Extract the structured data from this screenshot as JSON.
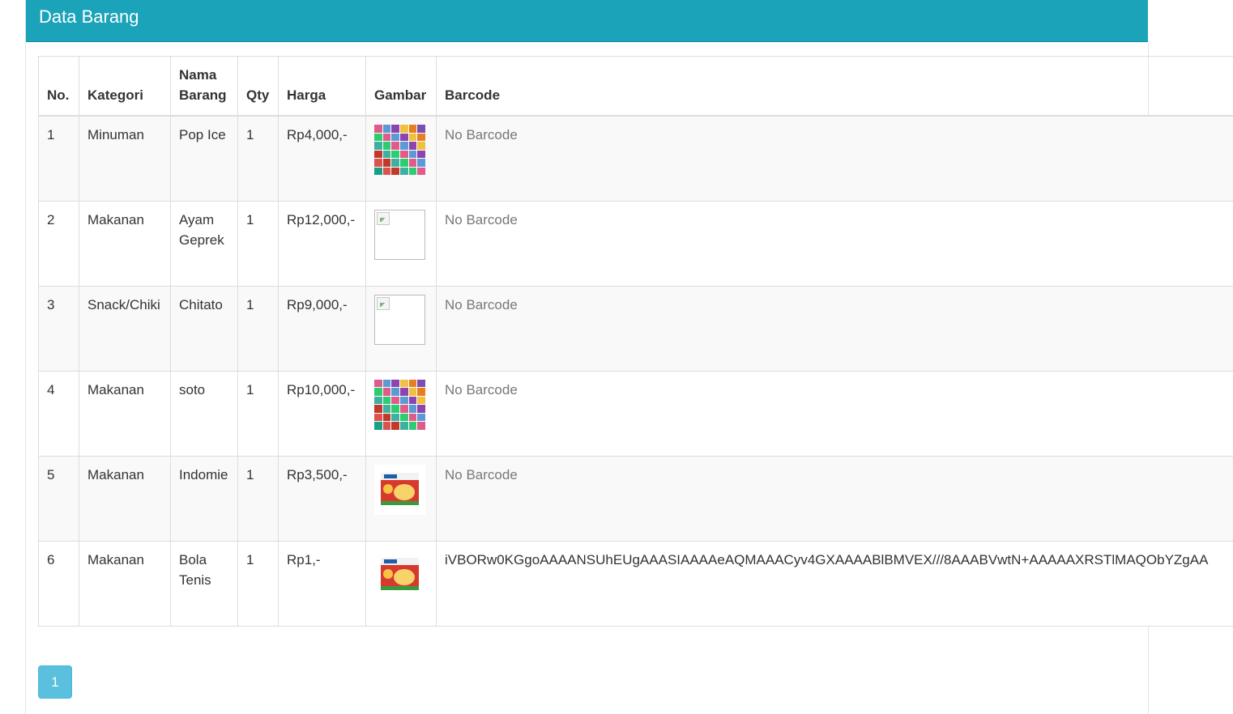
{
  "panel": {
    "title": "Data Barang"
  },
  "table": {
    "headers": {
      "no": "No.",
      "kategori": "Kategori",
      "nama_barang": "Nama Barang",
      "qty": "Qty",
      "harga": "Harga",
      "gambar": "Gambar",
      "barcode": "Barcode"
    },
    "rows": [
      {
        "no": "1",
        "kategori": "Minuman",
        "nama": "Pop Ice",
        "qty": "1",
        "harga": "Rp4,000,-",
        "gambar": "mosaic-product-image",
        "barcode": "No Barcode"
      },
      {
        "no": "2",
        "kategori": "Makanan",
        "nama": "Ayam Geprek",
        "qty": "1",
        "harga": "Rp12,000,-",
        "gambar": "broken-image",
        "barcode": "No Barcode"
      },
      {
        "no": "3",
        "kategori": "Snack/Chiki",
        "nama": "Chitato",
        "qty": "1",
        "harga": "Rp9,000,-",
        "gambar": "broken-image",
        "barcode": "No Barcode"
      },
      {
        "no": "4",
        "kategori": "Makanan",
        "nama": "soto",
        "qty": "1",
        "harga": "Rp10,000,-",
        "gambar": "mosaic-product-image",
        "barcode": "No Barcode"
      },
      {
        "no": "5",
        "kategori": "Makanan",
        "nama": "Indomie",
        "qty": "1",
        "harga": "Rp3,500,-",
        "gambar": "noodle-pack-image",
        "barcode": "No Barcode"
      },
      {
        "no": "6",
        "kategori": "Makanan",
        "nama": "Bola Tenis",
        "qty": "1",
        "harga": "Rp1,-",
        "gambar": "noodle-pack-image",
        "barcode": "iVBORw0KGgoAAAANSUhEUgAAASIAAAAeAQMAAACyv4GXAAAABlBMVEX///8AAABVwtN+AAAAAXRSTlMAQObYZgAA"
      }
    ]
  },
  "pagination": {
    "current": "1"
  },
  "colors": {
    "header": "#1aa3b9",
    "page_button": "#5bc0de"
  }
}
